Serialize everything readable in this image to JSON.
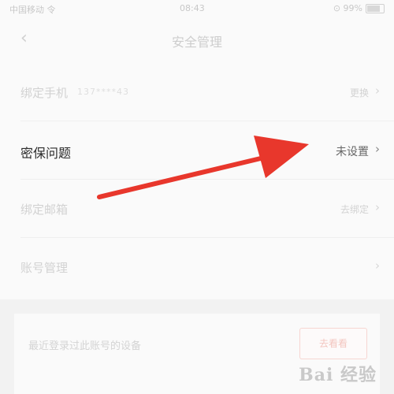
{
  "status_bar": {
    "carrier": "中国移动 令",
    "time": "08:43",
    "right_text": "⊙ 99%"
  },
  "nav": {
    "title": "安全管理"
  },
  "rows": [
    {
      "label": "绑定手机",
      "sub": "137****43",
      "value": "更换"
    },
    {
      "label": "密保问题",
      "value": "未设置"
    },
    {
      "label": "绑定邮箱",
      "value": "去绑定"
    },
    {
      "label": "账号管理",
      "value": ""
    }
  ],
  "card": {
    "text": "最近登录过此账号的设备",
    "button": "去看看"
  },
  "watermark": "Bai 经验",
  "icons": {
    "back": "chevron-left-icon",
    "chevron": "chevron-right-icon",
    "annotation": "red-arrow-icon"
  },
  "colors": {
    "arrow": "#e8372c",
    "highlight_text": "#2b2b2b"
  }
}
